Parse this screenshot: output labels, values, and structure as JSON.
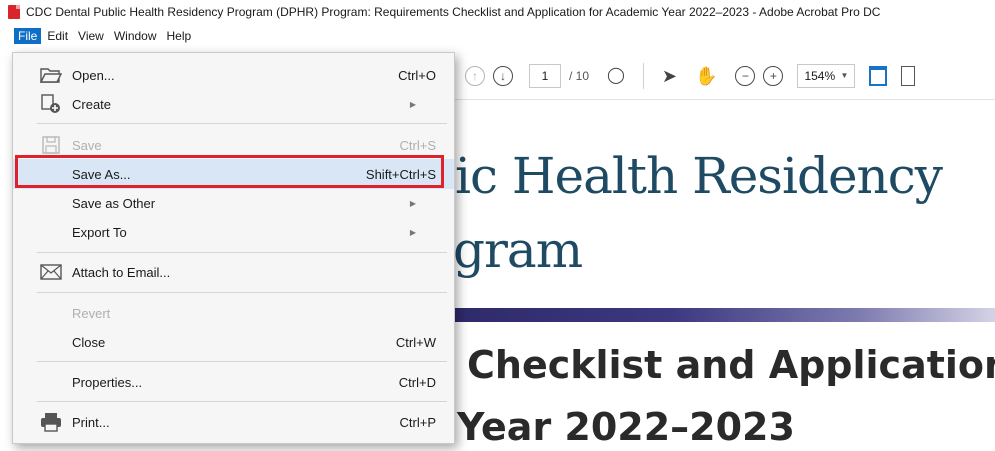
{
  "window": {
    "title": "CDC Dental Public Health Residency Program (DPHR) Program: Requirements Checklist and Application for Academic Year 2022–2023 - Adobe Acrobat Pro DC",
    "app_icon": "acrobat-pdf-icon"
  },
  "menubar": {
    "items": [
      {
        "label": "File",
        "active": true
      },
      {
        "label": "Edit",
        "active": false
      },
      {
        "label": "View",
        "active": false
      },
      {
        "label": "Window",
        "active": false
      },
      {
        "label": "Help",
        "active": false
      }
    ]
  },
  "toolbar": {
    "page_current": "1",
    "page_total": "/ 10",
    "zoom": "154%",
    "icons": [
      "prev-page-icon",
      "next-page-icon",
      "select-text-icon",
      "pointer-icon",
      "hand-icon",
      "zoom-out-icon",
      "zoom-in-icon",
      "fit-page-icon"
    ]
  },
  "file_menu": {
    "items": [
      {
        "label": "Open...",
        "shortcut": "Ctrl+O",
        "icon": "folder-open-icon",
        "enabled": true
      },
      {
        "label": "Create",
        "shortcut": "",
        "icon": "create-pdf-icon",
        "submenu": true,
        "enabled": true
      },
      {
        "label": "Save",
        "shortcut": "Ctrl+S",
        "icon": "save-disk-icon",
        "enabled": false
      },
      {
        "label": "Save As...",
        "shortcut": "Shift+Ctrl+S",
        "enabled": true,
        "highlighted": true
      },
      {
        "label": "Save as Other",
        "shortcut": "",
        "submenu": true,
        "enabled": true
      },
      {
        "label": "Export To",
        "shortcut": "",
        "submenu": true,
        "enabled": true
      },
      {
        "label": "Attach to Email...",
        "shortcut": "",
        "icon": "email-envelope-icon",
        "enabled": true
      },
      {
        "label": "Revert",
        "shortcut": "",
        "enabled": false
      },
      {
        "label": "Close",
        "shortcut": "Ctrl+W",
        "enabled": true
      },
      {
        "label": "Properties...",
        "shortcut": "Ctrl+D",
        "enabled": true
      },
      {
        "label": "Print...",
        "shortcut": "Ctrl+P",
        "icon": "printer-icon",
        "enabled": true
      }
    ]
  },
  "document": {
    "heading_line1": "ic Health Residency",
    "heading_line2": "gram",
    "subheading_line1": "Checklist and Application",
    "subheading_line2": "Year 2022–2023"
  },
  "colors": {
    "menu_active": "#0f6fc6",
    "highlight_frame": "#e0202a",
    "heading": "#1e4b63"
  }
}
